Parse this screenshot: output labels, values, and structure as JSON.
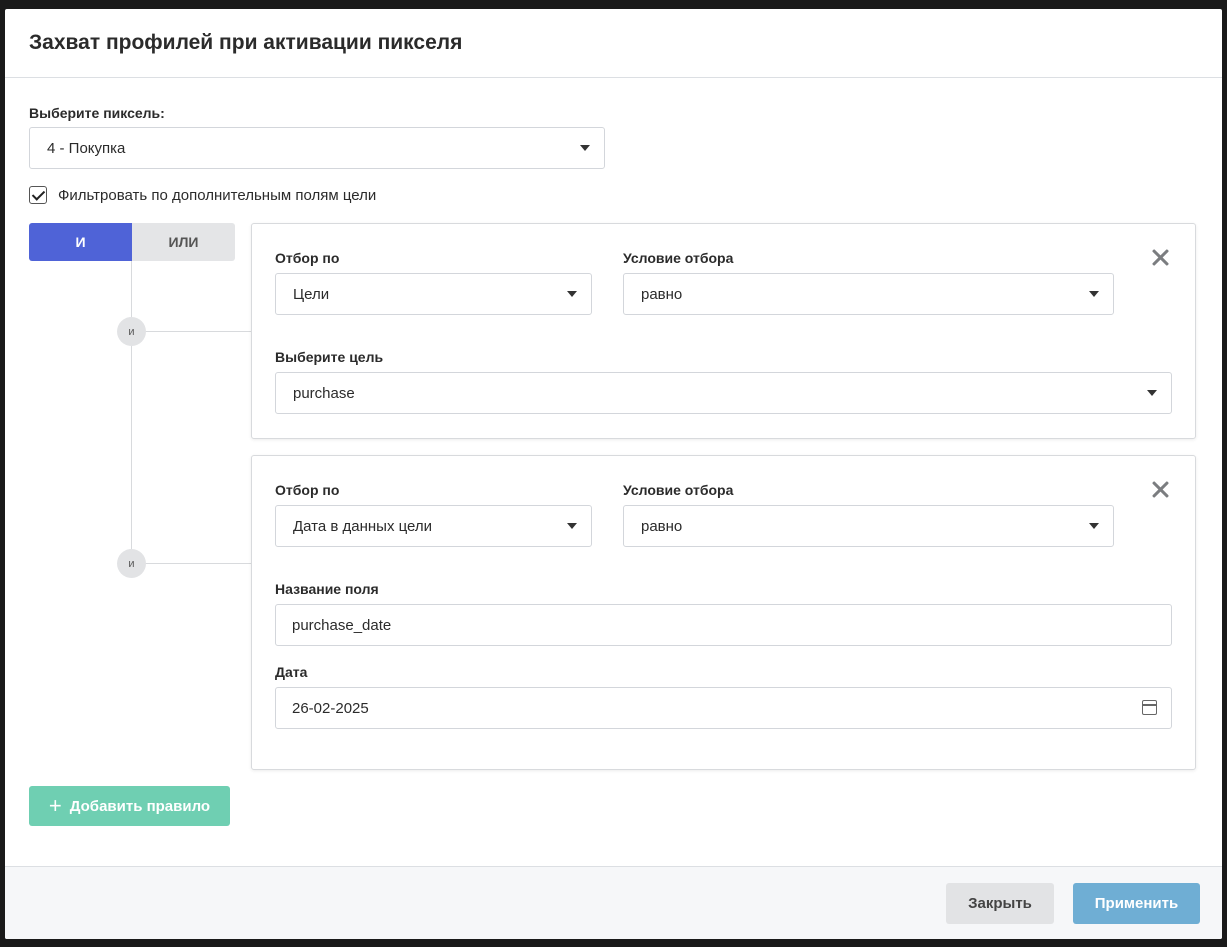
{
  "modal": {
    "title": "Захват профилей при активации пикселя"
  },
  "pixel": {
    "label": "Выберите пиксель:",
    "value": "4 - Покупка"
  },
  "filter_checkbox": {
    "label": "Фильтровать по дополнительным полям цели",
    "checked": true
  },
  "logic_toggle": {
    "and_label": "И",
    "or_label": "ИЛИ",
    "active": "and"
  },
  "node_label": "и",
  "rules": [
    {
      "filter_by_label": "Отбор по",
      "filter_by_value": "Цели",
      "condition_label": "Условие отбора",
      "condition_value": "равно",
      "goal_label": "Выберите цель",
      "goal_value": "purchase"
    },
    {
      "filter_by_label": "Отбор по",
      "filter_by_value": "Дата в данных цели",
      "condition_label": "Условие отбора",
      "condition_value": "равно",
      "field_name_label": "Название поля",
      "field_name_value": "purchase_date",
      "date_label": "Дата",
      "date_value": "26-02-2025"
    }
  ],
  "add_rule": {
    "icon": "+",
    "label": "Добавить правило"
  },
  "footer": {
    "close_label": "Закрыть",
    "apply_label": "Применить"
  }
}
